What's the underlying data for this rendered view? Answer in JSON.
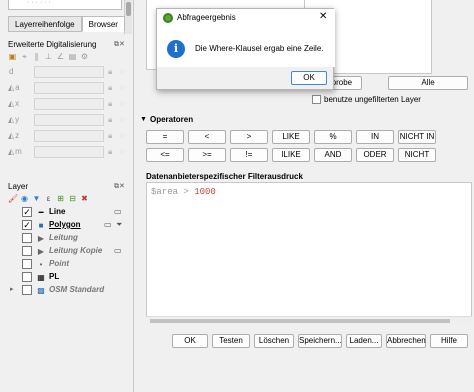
{
  "left_panel": {
    "tabs": [
      "Layerreihenfolge",
      "Browser"
    ],
    "digitizing_title": "Erweiterte Digitalisierung",
    "coord_fields": [
      {
        "label": "d"
      },
      {
        "label": "a"
      },
      {
        "label": "x"
      },
      {
        "label": "y"
      },
      {
        "label": "z"
      },
      {
        "label": "m"
      }
    ],
    "layer_title": "Layer",
    "layers": [
      {
        "name": "Line",
        "checked": true,
        "symbol": "line"
      },
      {
        "name": "Polygon",
        "checked": true,
        "symbol": "polygon",
        "selected": true
      },
      {
        "name": "Leitung",
        "checked": false,
        "symbol": "triangle"
      },
      {
        "name": "Leitung Kopie",
        "checked": false,
        "symbol": "triangle"
      },
      {
        "name": "Point",
        "checked": false,
        "symbol": "dot"
      },
      {
        "name": "PL",
        "checked": false,
        "symbol": "table"
      },
      {
        "name": "OSM Standard",
        "checked": false,
        "symbol": "tiles"
      }
    ]
  },
  "query": {
    "sample_button": "Stichprobe",
    "all_button": "Alle",
    "unfiltered_label": "benutze ungefilterten Layer",
    "operators_label": "Operatoren",
    "operators_row1": [
      "=",
      "<",
      ">",
      "LIKE",
      "%",
      "IN",
      "NICHT IN"
    ],
    "operators_row2": [
      "<=",
      ">=",
      "!=",
      "ILIKE",
      "AND",
      "ODER",
      "NICHT"
    ],
    "expression_label": "Datenanbieterspezifischer Filterausdruck",
    "expression": {
      "field": "$area",
      "operator": ">",
      "value": "1000"
    },
    "buttons": [
      "OK",
      "Testen",
      "Löschen",
      "Speichern...",
      "Laden...",
      "Abbrechen",
      "Hilfe"
    ]
  },
  "modal": {
    "title": "Abfrageergebnis",
    "message": "Die Where-Klausel ergab eine Zeile.",
    "ok_label": "OK",
    "icon": "info-icon"
  }
}
